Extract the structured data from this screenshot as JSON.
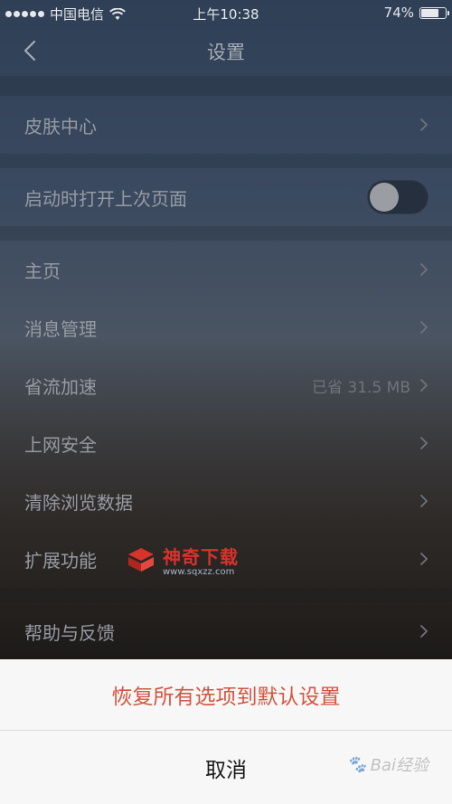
{
  "status_bar": {
    "carrier": "中国电信",
    "time": "上午10:38",
    "battery": "74%",
    "battery_level": 0.74,
    "icons": [
      "signal-dots-icon",
      "wifi-icon",
      "battery-icon"
    ]
  },
  "nav": {
    "title": "设置",
    "back_icon": "chevron-left-icon"
  },
  "rows": {
    "skin_center": {
      "label": "皮肤中心"
    },
    "open_last_page": {
      "label": "启动时打开上次页面",
      "toggle_on": false
    },
    "home": {
      "label": "主页"
    },
    "message_management": {
      "label": "消息管理"
    },
    "data_saver": {
      "label": "省流加速",
      "value": "已省 31.5 MB"
    },
    "web_security": {
      "label": "上网安全"
    },
    "clear_browsing_data": {
      "label": "清除浏览数据"
    },
    "extensions": {
      "label": "扩展功能"
    },
    "help_feedback": {
      "label": "帮助与反馈"
    }
  },
  "watermark": {
    "main": "神奇下载",
    "sub": "www.sqxzz.com"
  },
  "action_sheet": {
    "reset_all": "恢复所有选项到默认设置",
    "cancel": "取消"
  },
  "corner_watermark": {
    "text": "Bai经验"
  },
  "colors": {
    "destructive": "#d2553f",
    "sheet_bg": "#f7f7f7",
    "watermark_red": "#d8332b"
  }
}
